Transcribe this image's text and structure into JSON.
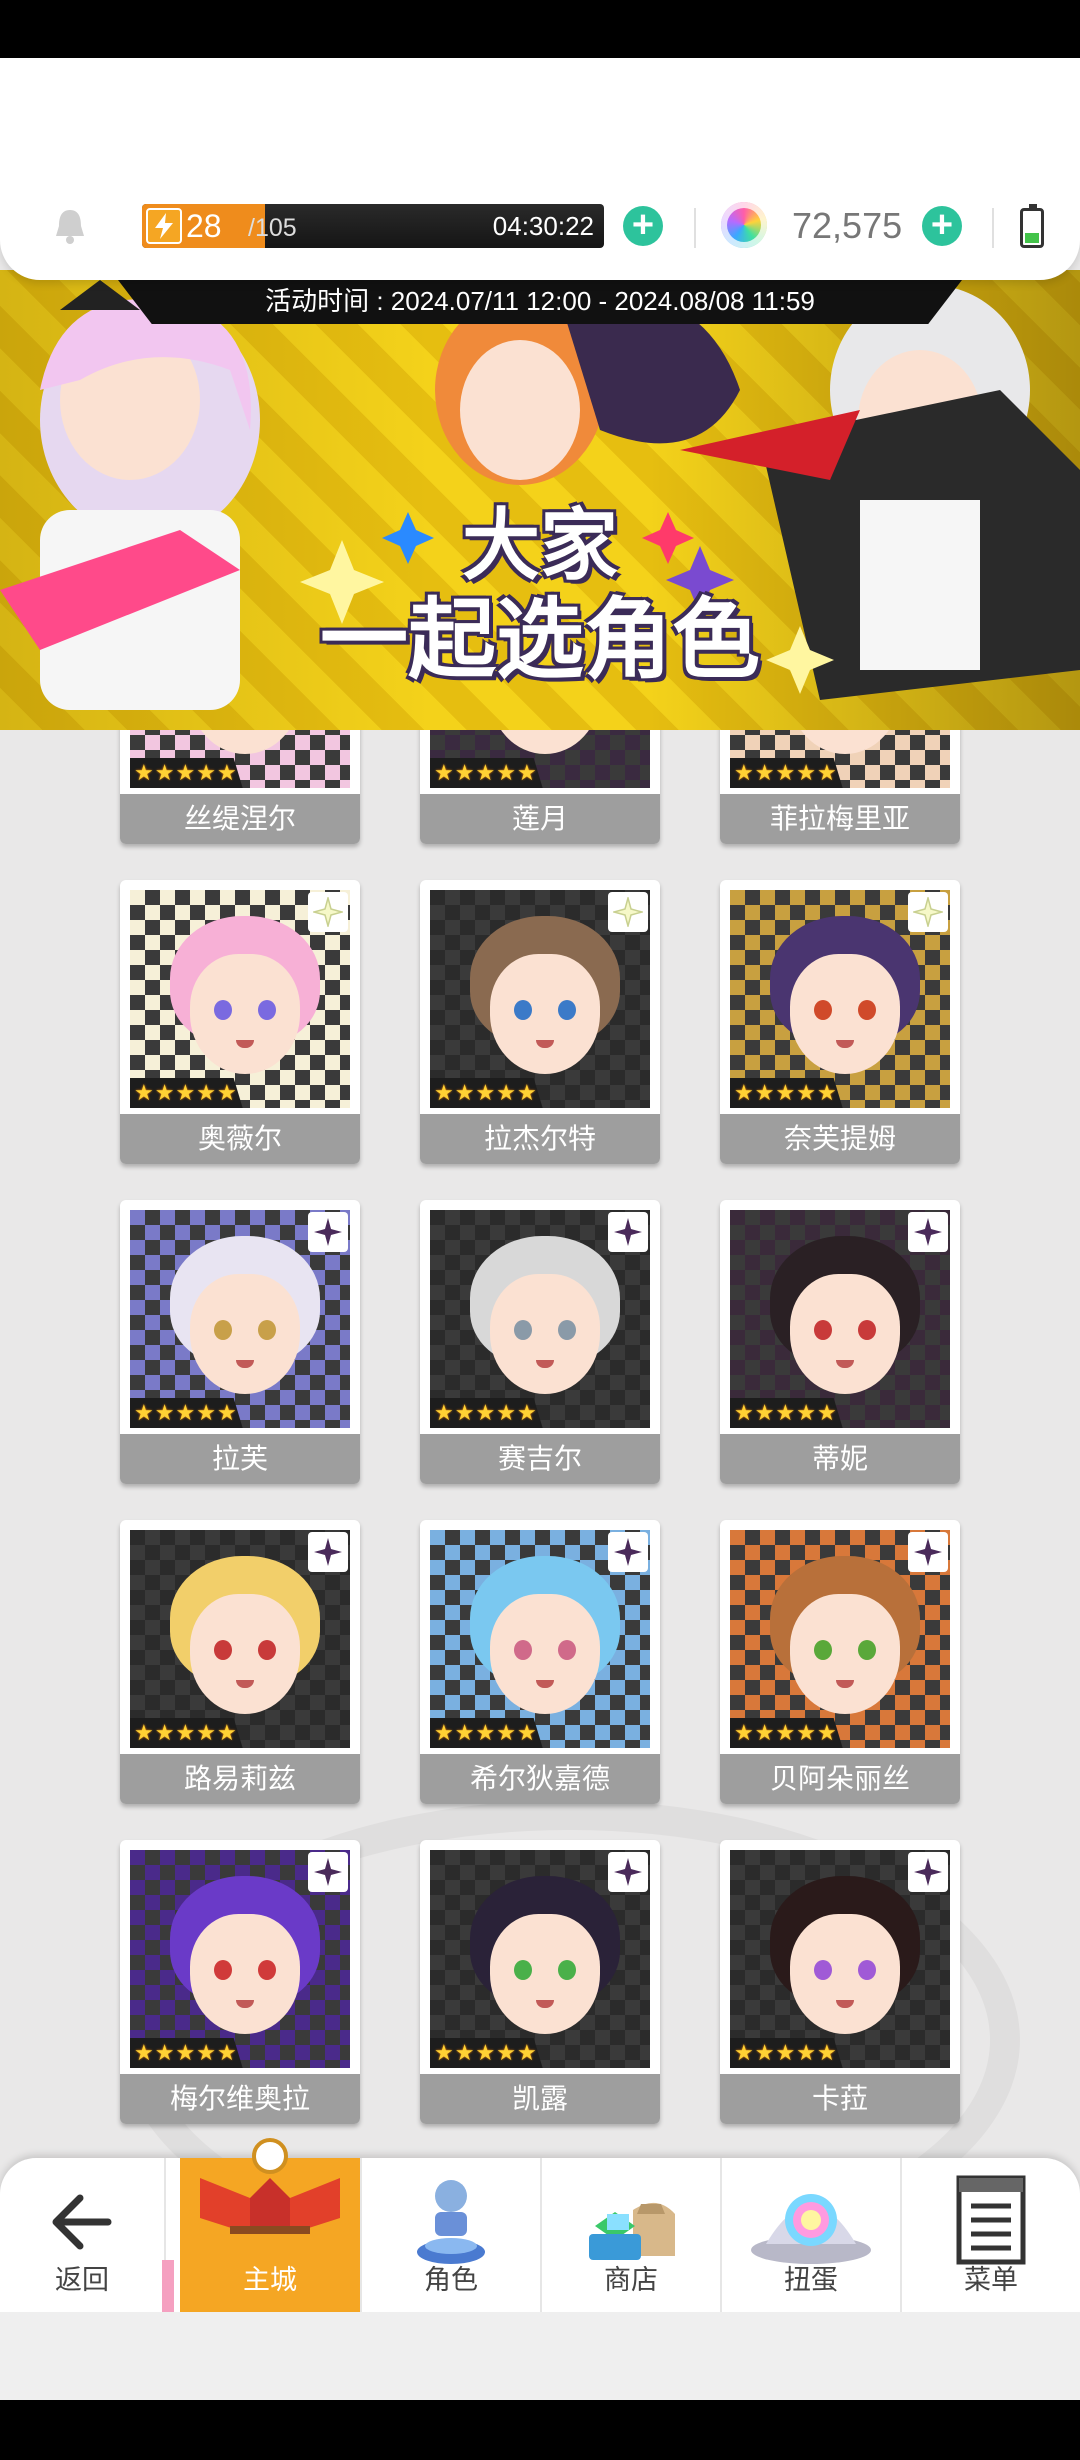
{
  "header": {
    "stamina_current": "28",
    "stamina_max": "/105",
    "stamina_fraction": 0.267,
    "stamina_timer": "04:30:22",
    "gem_count": "72,575",
    "battery_level": 0.4
  },
  "banner": {
    "event_time": "活动时间 : 2024.07/11 12:00 - 2024.08/08 11:59",
    "title_line1": "大家",
    "title_line2": "一起选角色"
  },
  "characters": [
    {
      "name": "丝缇涅尔",
      "stars": 5,
      "badge": "none",
      "hair": "#e8a6d8",
      "eye": "#8a5ad6",
      "bg": "#f2c6e0",
      "partial": true
    },
    {
      "name": "莲月",
      "stars": 5,
      "badge": "none",
      "hair": "#3b2a4e",
      "eye": "#8b2a2a",
      "bg": "#3a2a40",
      "partial": true
    },
    {
      "name": "菲拉梅里亚",
      "stars": 5,
      "badge": "none",
      "hair": "#7fd6c0",
      "eye": "#3ca88a",
      "bg": "#f0d2b8",
      "partial": true
    },
    {
      "name": "奥薇尔",
      "stars": 5,
      "badge": "sparkle-light",
      "hair": "#f7b0d6",
      "eye": "#7a6ae0",
      "bg": "#f6f0d8",
      "partial": false
    },
    {
      "name": "拉杰尔特",
      "stars": 5,
      "badge": "sparkle-light",
      "hair": "#8a6a50",
      "eye": "#3b7ac8",
      "bg": "#2b2b2b",
      "partial": false
    },
    {
      "name": "奈芙提姆",
      "stars": 5,
      "badge": "sparkle-light",
      "hair": "#4a3570",
      "eye": "#d04a2a",
      "bg": "#c8a040",
      "partial": false
    },
    {
      "name": "拉芙",
      "stars": 5,
      "badge": "sparkle-dark",
      "hair": "#e8e4f2",
      "eye": "#c8a04a",
      "bg": "#7a7ac8",
      "partial": false
    },
    {
      "name": "赛吉尔",
      "stars": 5,
      "badge": "sparkle-dark",
      "hair": "#d8d8d8",
      "eye": "#8a9aa8",
      "bg": "#2b2b2b",
      "partial": false
    },
    {
      "name": "蒂妮",
      "stars": 5,
      "badge": "sparkle-dark",
      "hair": "#2a2024",
      "eye": "#c83a3a",
      "bg": "#3a2a3a",
      "partial": false
    },
    {
      "name": "路易莉兹",
      "stars": 5,
      "badge": "sparkle-dark",
      "hair": "#f2cf6a",
      "eye": "#c83a3a",
      "bg": "#2b2b2b",
      "partial": false
    },
    {
      "name": "希尔狄嘉德",
      "stars": 5,
      "badge": "sparkle-dark",
      "hair": "#7ac8f0",
      "eye": "#d06a8a",
      "bg": "#7ab0e0",
      "partial": false
    },
    {
      "name": "贝阿朵丽丝",
      "stars": 5,
      "badge": "sparkle-dark",
      "hair": "#b8703a",
      "eye": "#5aa83a",
      "bg": "#d8783a",
      "partial": false
    },
    {
      "name": "梅尔维奥拉",
      "stars": 5,
      "badge": "sparkle-dark",
      "hair": "#6a3ac8",
      "eye": "#d03a3a",
      "bg": "#4a2a8a",
      "partial": false
    },
    {
      "name": "凯露",
      "stars": 5,
      "badge": "sparkle-dark",
      "hair": "#2a2238",
      "eye": "#4ab04a",
      "bg": "#2b2b2b",
      "partial": false
    },
    {
      "name": "卡菈",
      "stars": 5,
      "badge": "sparkle-dark",
      "hair": "#2a1a1a",
      "eye": "#a05ad6",
      "bg": "#2b2b2b",
      "partial": false
    }
  ],
  "nav": {
    "back": "返回",
    "main_city": "主城",
    "characters": "角色",
    "shop": "商店",
    "gacha": "扭蛋",
    "menu": "菜单"
  },
  "colors": {
    "accent_orange": "#f5a623",
    "plus_green": "#2dc39c",
    "name_bar_gray": "#9e9e9e",
    "banner_yellow": "#f4d21a"
  }
}
